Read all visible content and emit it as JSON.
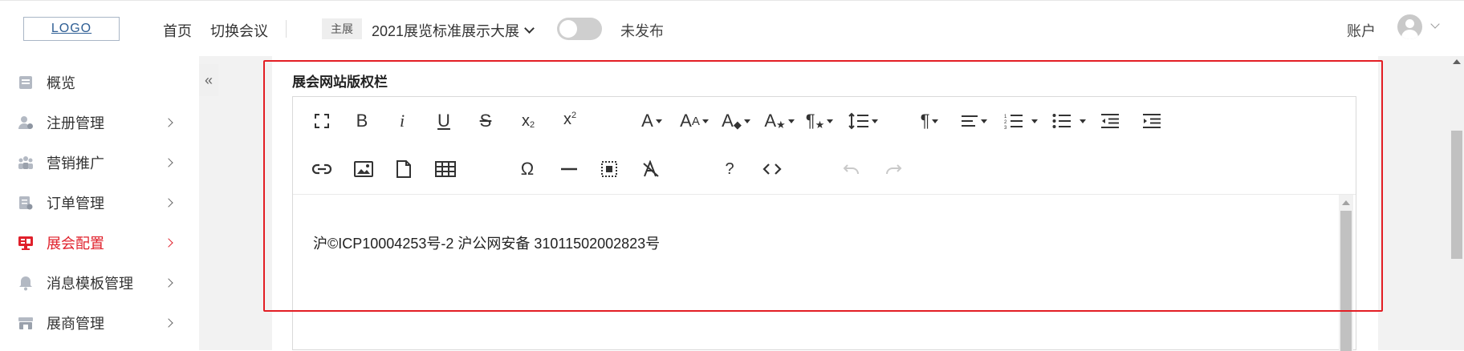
{
  "header": {
    "logo": "LOGO",
    "nav": [
      "首页",
      "切换会议"
    ],
    "main_tag": "主展",
    "expo_name": "2021展览标准展示大展",
    "publish_status": "未发布",
    "account": "账户"
  },
  "sidebar": {
    "items": [
      {
        "label": "概览",
        "icon": "overview-icon",
        "has_arrow": false
      },
      {
        "label": "注册管理",
        "icon": "user-reg-icon",
        "has_arrow": true
      },
      {
        "label": "营销推广",
        "icon": "marketing-icon",
        "has_arrow": true
      },
      {
        "label": "订单管理",
        "icon": "order-icon",
        "has_arrow": true
      },
      {
        "label": "展会配置",
        "icon": "monitor-config-icon",
        "has_arrow": true,
        "active": true
      },
      {
        "label": "消息模板管理",
        "icon": "bell-icon",
        "has_arrow": true
      },
      {
        "label": "展商管理",
        "icon": "store-icon",
        "has_arrow": true
      }
    ],
    "collapse_symbol": "«"
  },
  "section": {
    "title": "展会网站版权栏"
  },
  "editor": {
    "content": "沪©ICP10004253号-2 沪公网安备 31011502002823号",
    "help_symbol": "?"
  },
  "colors": {
    "accent": "#e0202b",
    "highlight": "#e31e24"
  }
}
